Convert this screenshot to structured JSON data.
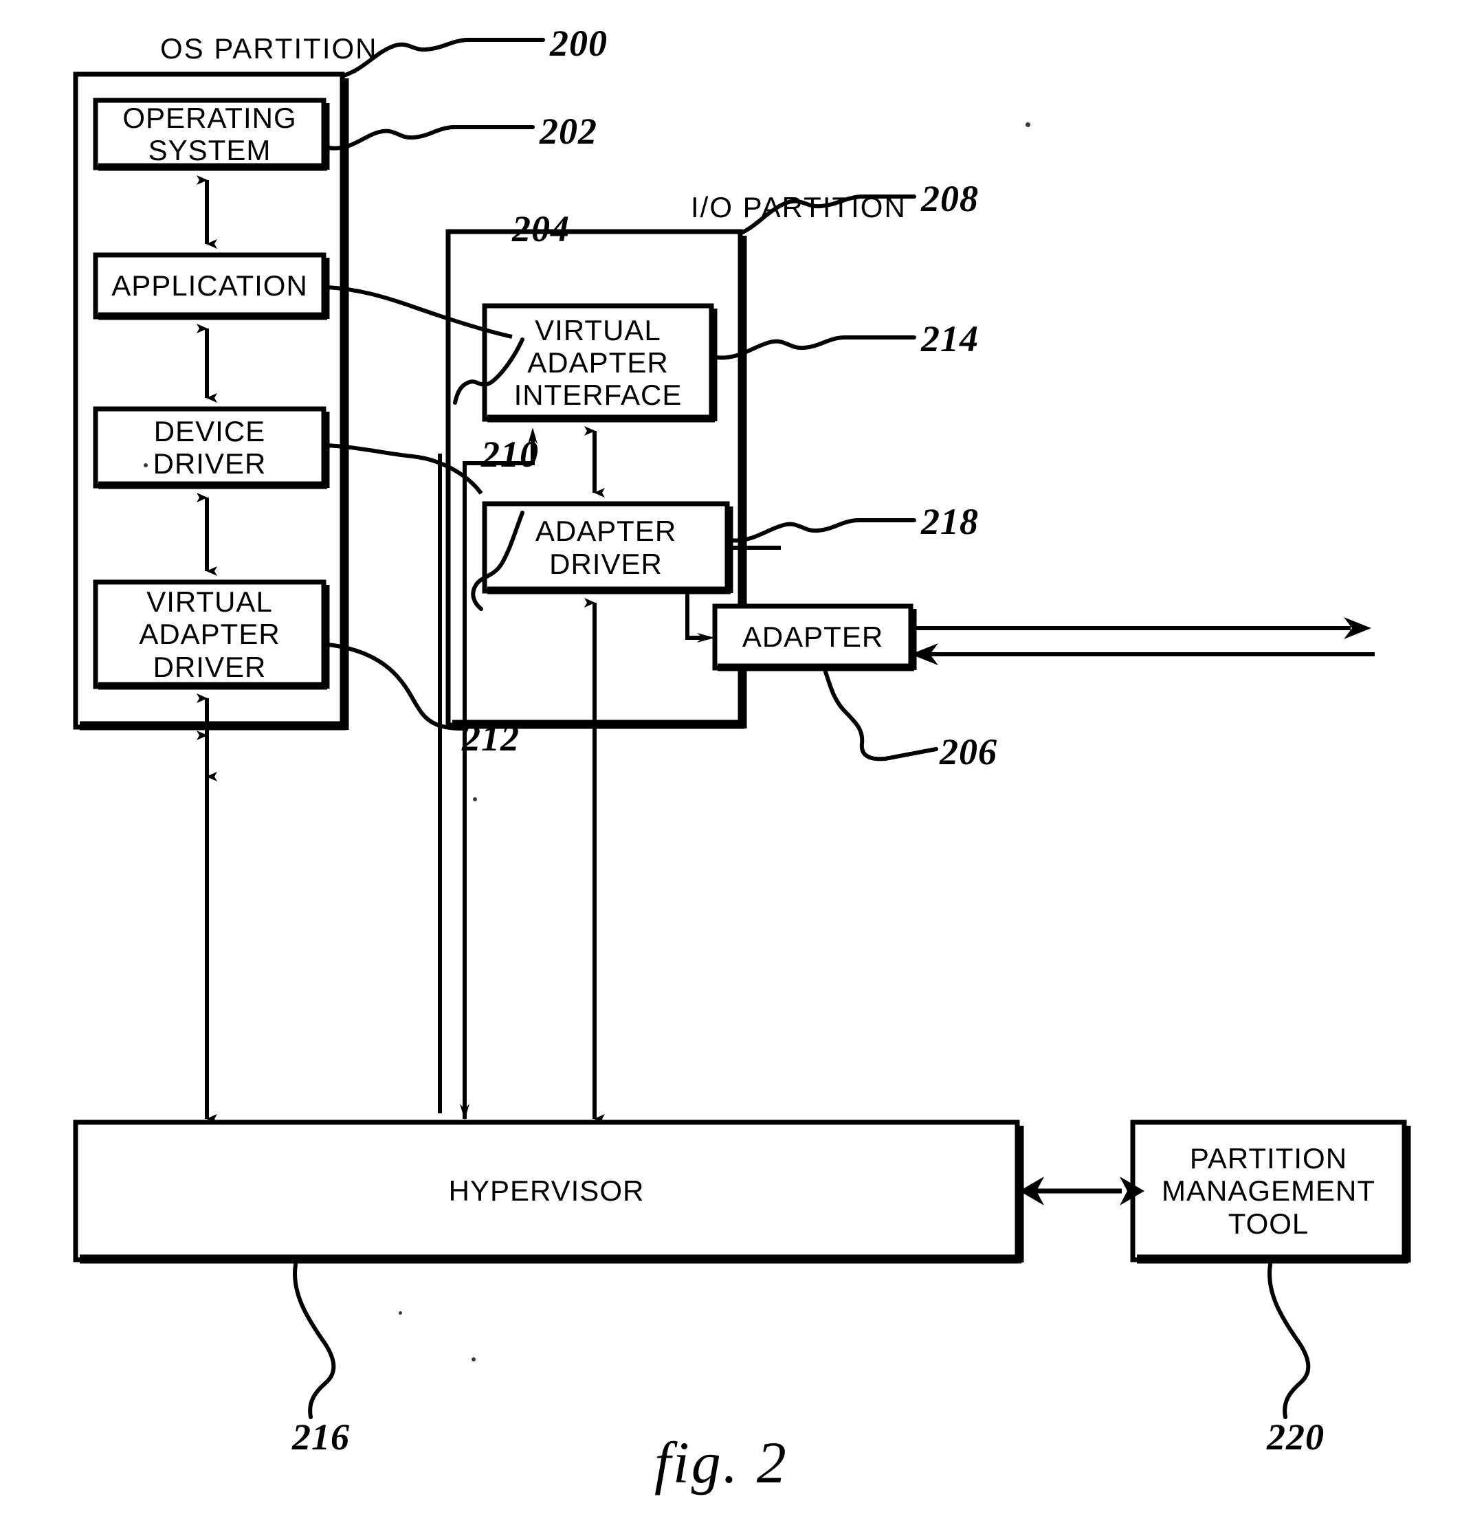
{
  "figure": {
    "caption": "fig. 2",
    "partitions": [
      {
        "id": "os-partition",
        "title": "OS PARTITION",
        "ref": "200"
      },
      {
        "id": "io-partition",
        "title": "I/O PARTITION",
        "ref": "208"
      }
    ],
    "boxes": [
      {
        "id": "operating-system",
        "label": "OPERATING\nSYSTEM",
        "ref": "202"
      },
      {
        "id": "application",
        "label": "APPLICATION",
        "ref": "204"
      },
      {
        "id": "device-driver",
        "label": "DEVICE\nDRIVER",
        "ref": "210"
      },
      {
        "id": "virtual-adapter-driver",
        "label": "VIRTUAL\nADAPTER\nDRIVER",
        "ref": "212"
      },
      {
        "id": "virtual-adapter-interface",
        "label": "VIRTUAL\nADAPTER\nINTERFACE",
        "ref": "214"
      },
      {
        "id": "adapter-driver",
        "label": "ADAPTER\nDRIVER",
        "ref": "218"
      },
      {
        "id": "adapter",
        "label": "ADAPTER",
        "ref": "206"
      },
      {
        "id": "hypervisor",
        "label": "HYPERVISOR",
        "ref": "216"
      },
      {
        "id": "partition-management-tool",
        "label": "PARTITION\nMANAGEMENT\nTOOL",
        "ref": "220"
      }
    ],
    "reference_numerals": {
      "os_partition": "200",
      "operating_system": "202",
      "application": "204",
      "adapter": "206",
      "io_partition": "208",
      "device_driver": "210",
      "virtual_adapter_driver": "212",
      "virtual_adapter_interface": "214",
      "hypervisor": "216",
      "adapter_driver": "218",
      "partition_management_tool": "220"
    },
    "colors": {
      "ink": "#000000",
      "paper": "#ffffff"
    }
  }
}
